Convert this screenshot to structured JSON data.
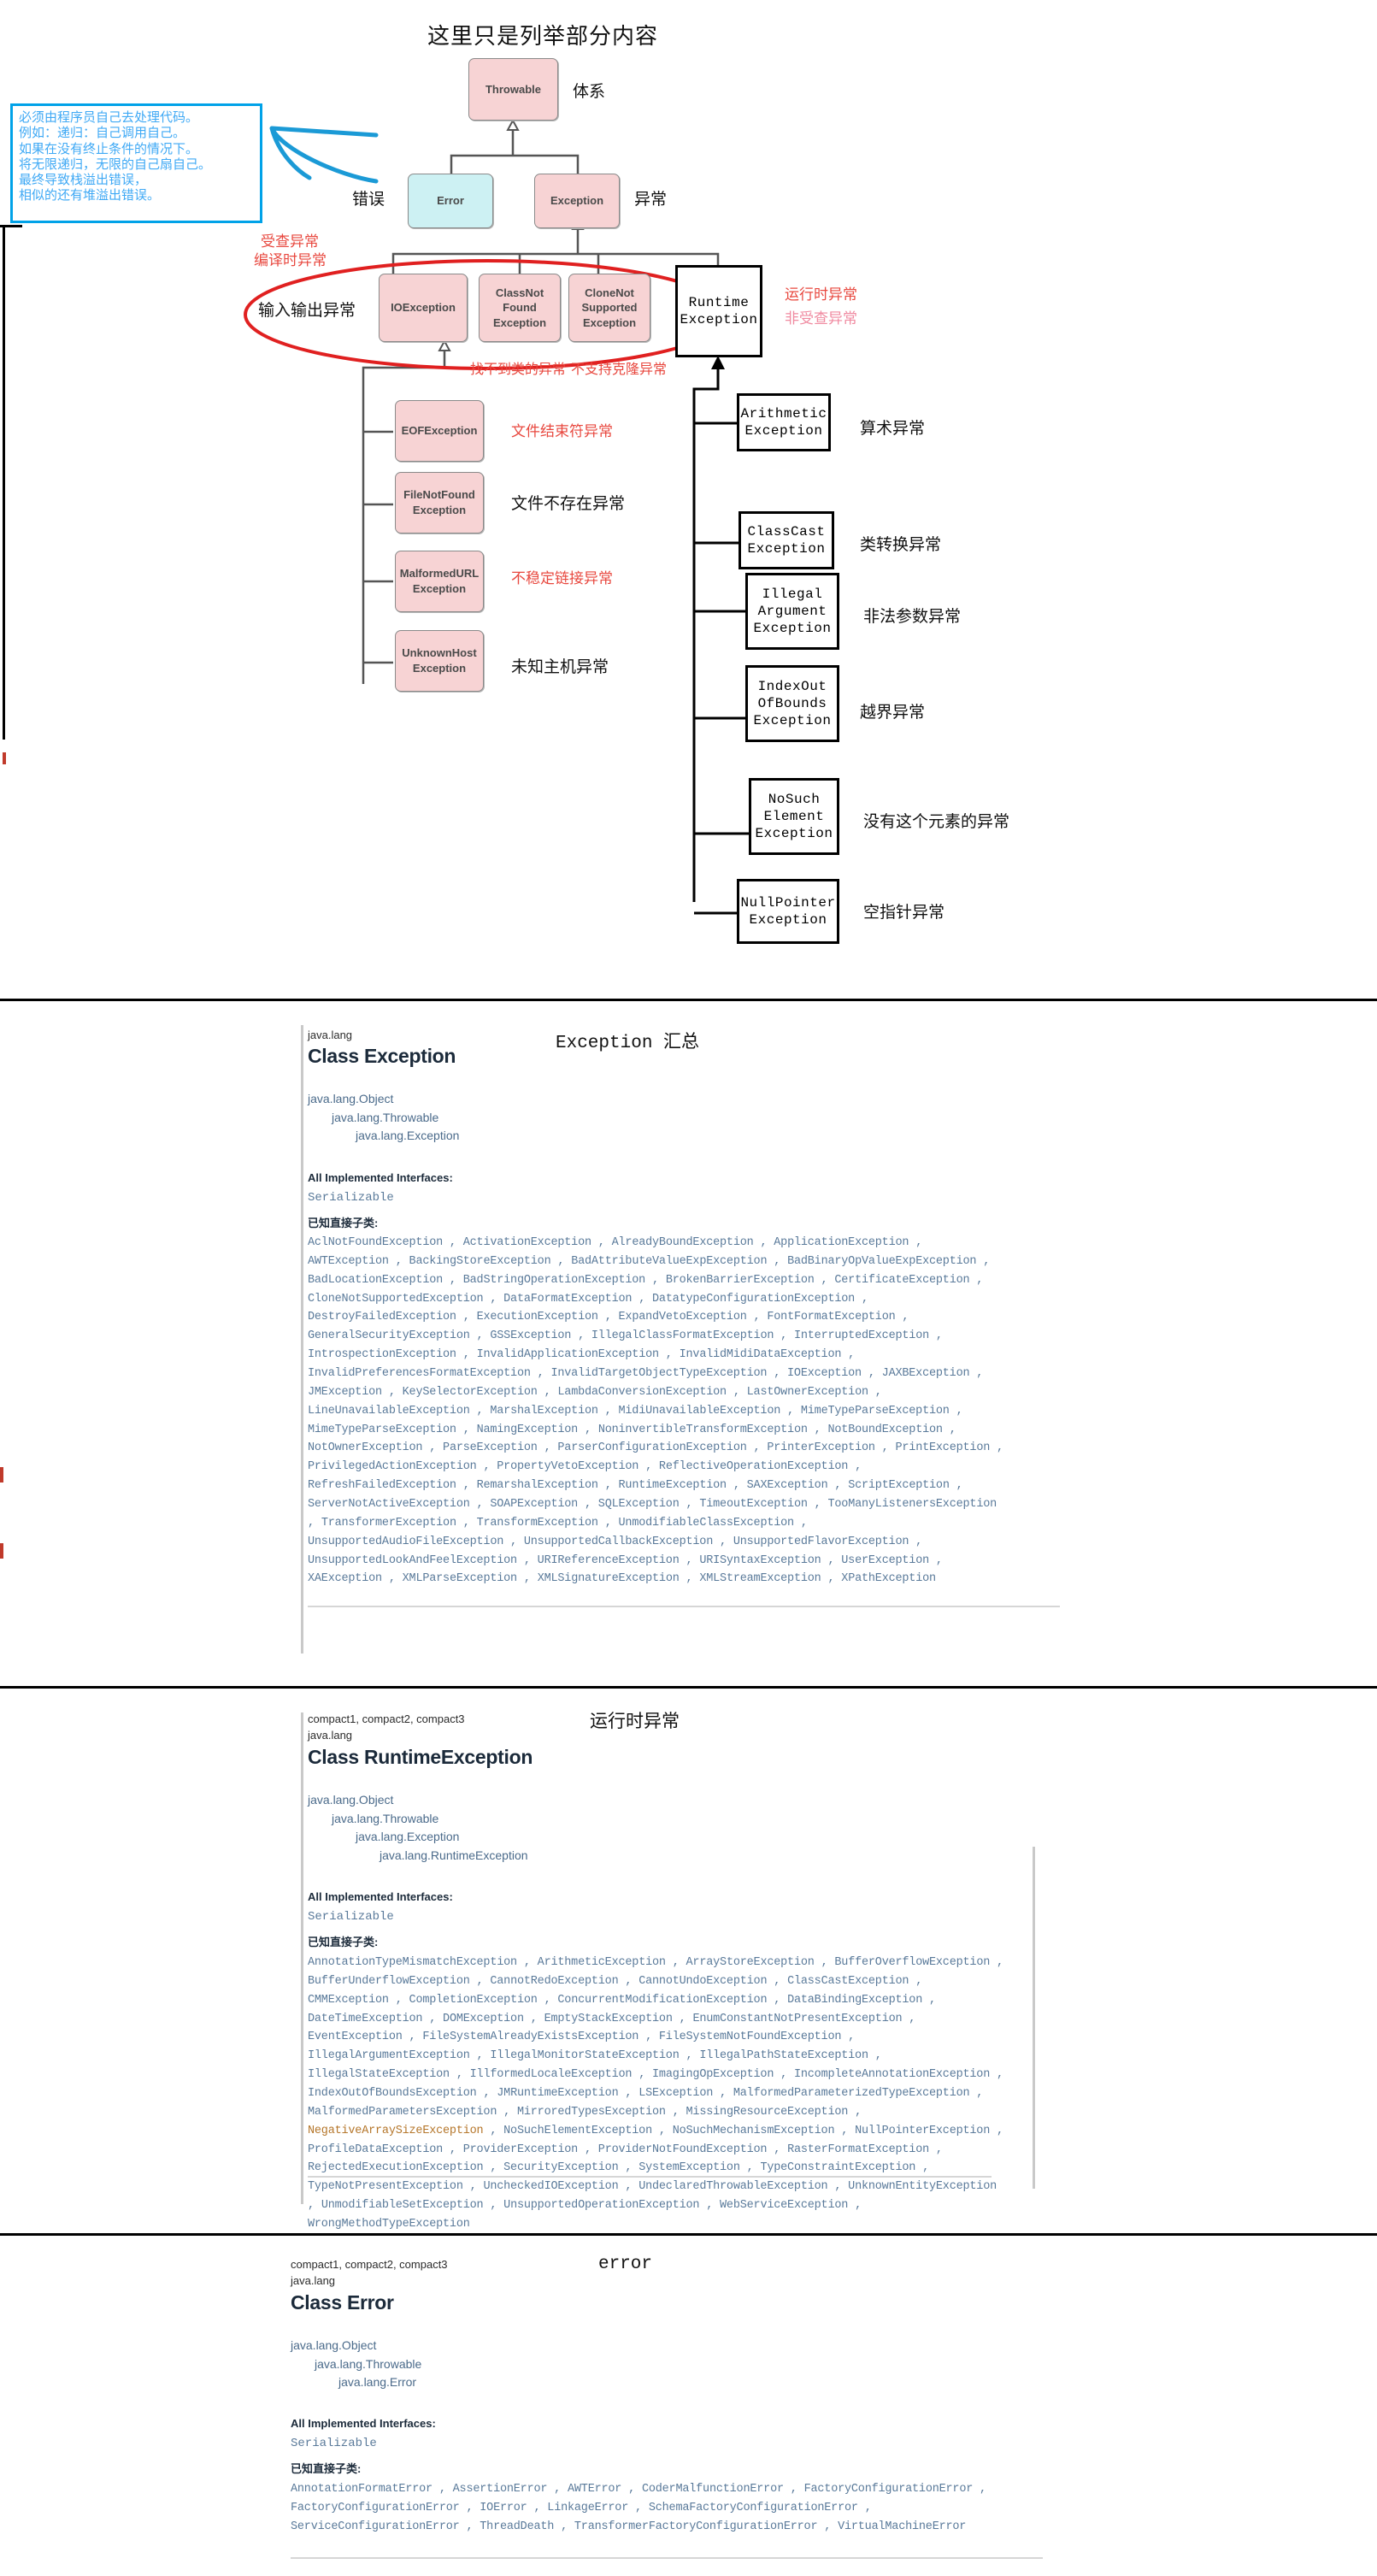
{
  "diagram": {
    "header_title": "这里只是列举部分内容",
    "callout": {
      "lines": [
        "必须由程序员自己去处理代码。",
        "例如：递归：自己调用自己。",
        "如果在没有终止条件的情况下。",
        "将无限递归，无限的自己扇自己。",
        "最终导致栈溢出错误，",
        "相似的还有堆溢出错误。"
      ],
      "border_color": "#00a2e8",
      "text_color": "#3fa9f5"
    },
    "nodes": {
      "throwable": "Throwable",
      "error": "Error",
      "exception": "Exception",
      "ioexception": "IOException",
      "classnotfound": "ClassNot\nFound\nException",
      "clonenotsupported": "CloneNot\nSupported\nException",
      "runtimeexception": "Runtime\nException",
      "eofexception": "EOFException",
      "filenotfound": "FileNotFound\nException",
      "malformedurl": "MalformedURL\nException",
      "unknownhost": "UnknownHost\nException",
      "arithmetic": "Arithmetic\nException",
      "classcast": "ClassCast\nException",
      "illegalargument": "Illegal\nArgument\nException",
      "indexoutofbounds": "IndexOut\nOfBounds\nException",
      "nosuchelement": "NoSuch\nElement\nException",
      "nullpointer": "NullPointer\nException"
    },
    "annotations": {
      "throwable_note": "体系",
      "error_note": "错误",
      "exception_note": "异常",
      "checked_line1": "受查异常",
      "checked_line2": "编译时异常",
      "io_note": "输入输出异常",
      "classnotfound_note": "找不到类的异常",
      "clonenotsupported_note": "不支持克隆异常",
      "runtime_line1": "运行时异常",
      "runtime_line2": "非受查异常",
      "eof_note": "文件结束符异常",
      "filenotfound_note": "文件不存在异常",
      "malformedurl_note": "不稳定链接异常",
      "unknownhost_note": "未知主机异常",
      "arithmetic_note": "算术异常",
      "classcast_note": "类转换异常",
      "illegalargument_note": "非法参数异常",
      "indexoutofbounds_note": "越界异常",
      "nosuchelement_note": "没有这个元素的异常",
      "nullpointer_note": "空指针异常"
    },
    "colors": {
      "pink_box": "#f7d3d4",
      "blue_box": "#cdf1f3",
      "red_annotation": "#e8483f",
      "pink_annotation": "#f08aa0",
      "ellipse_red": "#e02020",
      "arrow_blue": "#1b9ad6"
    }
  },
  "exception_doc": {
    "section_title": "Exception 汇总",
    "package": "java.lang",
    "class_title": "Class Exception",
    "tree": [
      "java.lang.Object",
      "java.lang.Throwable",
      "java.lang.Exception"
    ],
    "interfaces_heading": "All Implemented Interfaces:",
    "interfaces": "Serializable",
    "subclasses_heading": "已知直接子类:",
    "subclasses": [
      "AclNotFoundException",
      "ActivationException",
      "AlreadyBoundException",
      "ApplicationException",
      "AWTException",
      "BackingStoreException",
      "BadAttributeValueExpException",
      "BadBinaryOpValueExpException",
      "BadLocationException",
      "BadStringOperationException",
      "BrokenBarrierException",
      "CertificateException",
      "CloneNotSupportedException",
      "DataFormatException",
      "DatatypeConfigurationException",
      "DestroyFailedException",
      "ExecutionException",
      "ExpandVetoException",
      "FontFormatException",
      "GeneralSecurityException",
      "GSSException",
      "IllegalClassFormatException",
      "InterruptedException",
      "IntrospectionException",
      "InvalidApplicationException",
      "InvalidMidiDataException",
      "InvalidPreferencesFormatException",
      "InvalidTargetObjectTypeException",
      "IOException",
      "JAXBException",
      "JMException",
      "KeySelectorException",
      "LambdaConversionException",
      "LastOwnerException",
      "LineUnavailableException",
      "MarshalException",
      "MidiUnavailableException",
      "MimeTypeParseException",
      "MimeTypeParseException",
      "NamingException",
      "NoninvertibleTransformException",
      "NotBoundException",
      "NotOwnerException",
      "ParseException",
      "ParserConfigurationException",
      "PrinterException",
      "PrintException",
      "PrivilegedActionException",
      "PropertyVetoException",
      "ReflectiveOperationException",
      "RefreshFailedException",
      "RemarshalException",
      "RuntimeException",
      "SAXException",
      "ScriptException",
      "ServerNotActiveException",
      "SOAPException",
      "SQLException",
      "TimeoutException",
      "TooManyListenersException",
      "TransformerException",
      "TransformException",
      "UnmodifiableClassException",
      "UnsupportedAudioFileException",
      "UnsupportedCallbackException",
      "UnsupportedFlavorException",
      "UnsupportedLookAndFeelException",
      "URIReferenceException",
      "URISyntaxException",
      "UserException",
      "XAException",
      "XMLParseException",
      "XMLSignatureException",
      "XMLStreamException",
      "XPathException"
    ]
  },
  "runtime_doc": {
    "section_title": "运行时异常",
    "profiles": "compact1, compact2, compact3",
    "package": "java.lang",
    "class_title": "Class RuntimeException",
    "tree": [
      "java.lang.Object",
      "java.lang.Throwable",
      "java.lang.Exception",
      "java.lang.RuntimeException"
    ],
    "interfaces_heading": "All Implemented Interfaces:",
    "interfaces": "Serializable",
    "subclasses_heading": "已知直接子类:",
    "subclasses": [
      "AnnotationTypeMismatchException",
      "ArithmeticException",
      "ArrayStoreException",
      "BufferOverflowException",
      "BufferUnderflowException",
      "CannotRedoException",
      "CannotUndoException",
      "ClassCastException",
      "CMMException",
      "CompletionException",
      "ConcurrentModificationException",
      "DataBindingException",
      "DateTimeException",
      "DOMException",
      "EmptyStackException",
      "EnumConstantNotPresentException",
      "EventException",
      "FileSystemAlreadyExistsException",
      "FileSystemNotFoundException",
      "IllegalArgumentException",
      "IllegalMonitorStateException",
      "IllegalPathStateException",
      "IllegalStateException",
      "IllformedLocaleException",
      "ImagingOpException",
      "IncompleteAnnotationException",
      "IndexOutOfBoundsException",
      "JMRuntimeException",
      "LSException",
      "MalformedParameterizedTypeException",
      "MalformedParametersException",
      "MirroredTypesException",
      "MissingResourceException",
      "NegativeArraySizeException",
      "NoSuchElementException",
      "NoSuchMechanismException",
      "NullPointerException",
      "ProfileDataException",
      "ProviderException",
      "ProviderNotFoundException",
      "RasterFormatException",
      "RejectedExecutionException",
      "SecurityException",
      "SystemException",
      "TypeConstraintException",
      "TypeNotPresentException",
      "UncheckedIOException",
      "UndeclaredThrowableException",
      "UnknownEntityException",
      "UnmodifiableSetException",
      "UnsupportedOperationException",
      "WebServiceException",
      "WrongMethodTypeException"
    ],
    "highlighted_subclass": "NegativeArraySizeException"
  },
  "error_doc": {
    "section_title": "error",
    "profiles": "compact1, compact2, compact3",
    "package": "java.lang",
    "class_title": "Class Error",
    "tree": [
      "java.lang.Object",
      "java.lang.Throwable",
      "java.lang.Error"
    ],
    "interfaces_heading": "All Implemented Interfaces:",
    "interfaces": "Serializable",
    "subclasses_heading": "已知直接子类:",
    "subclasses": [
      "AnnotationFormatError",
      "AssertionError",
      "AWTError",
      "CoderMalfunctionError",
      "FactoryConfigurationError",
      "FactoryConfigurationError",
      "IOError",
      "LinkageError",
      "SchemaFactoryConfigurationError",
      "ServiceConfigurationError",
      "ThreadDeath",
      "TransformerFactoryConfigurationError",
      "VirtualMachineError"
    ]
  }
}
